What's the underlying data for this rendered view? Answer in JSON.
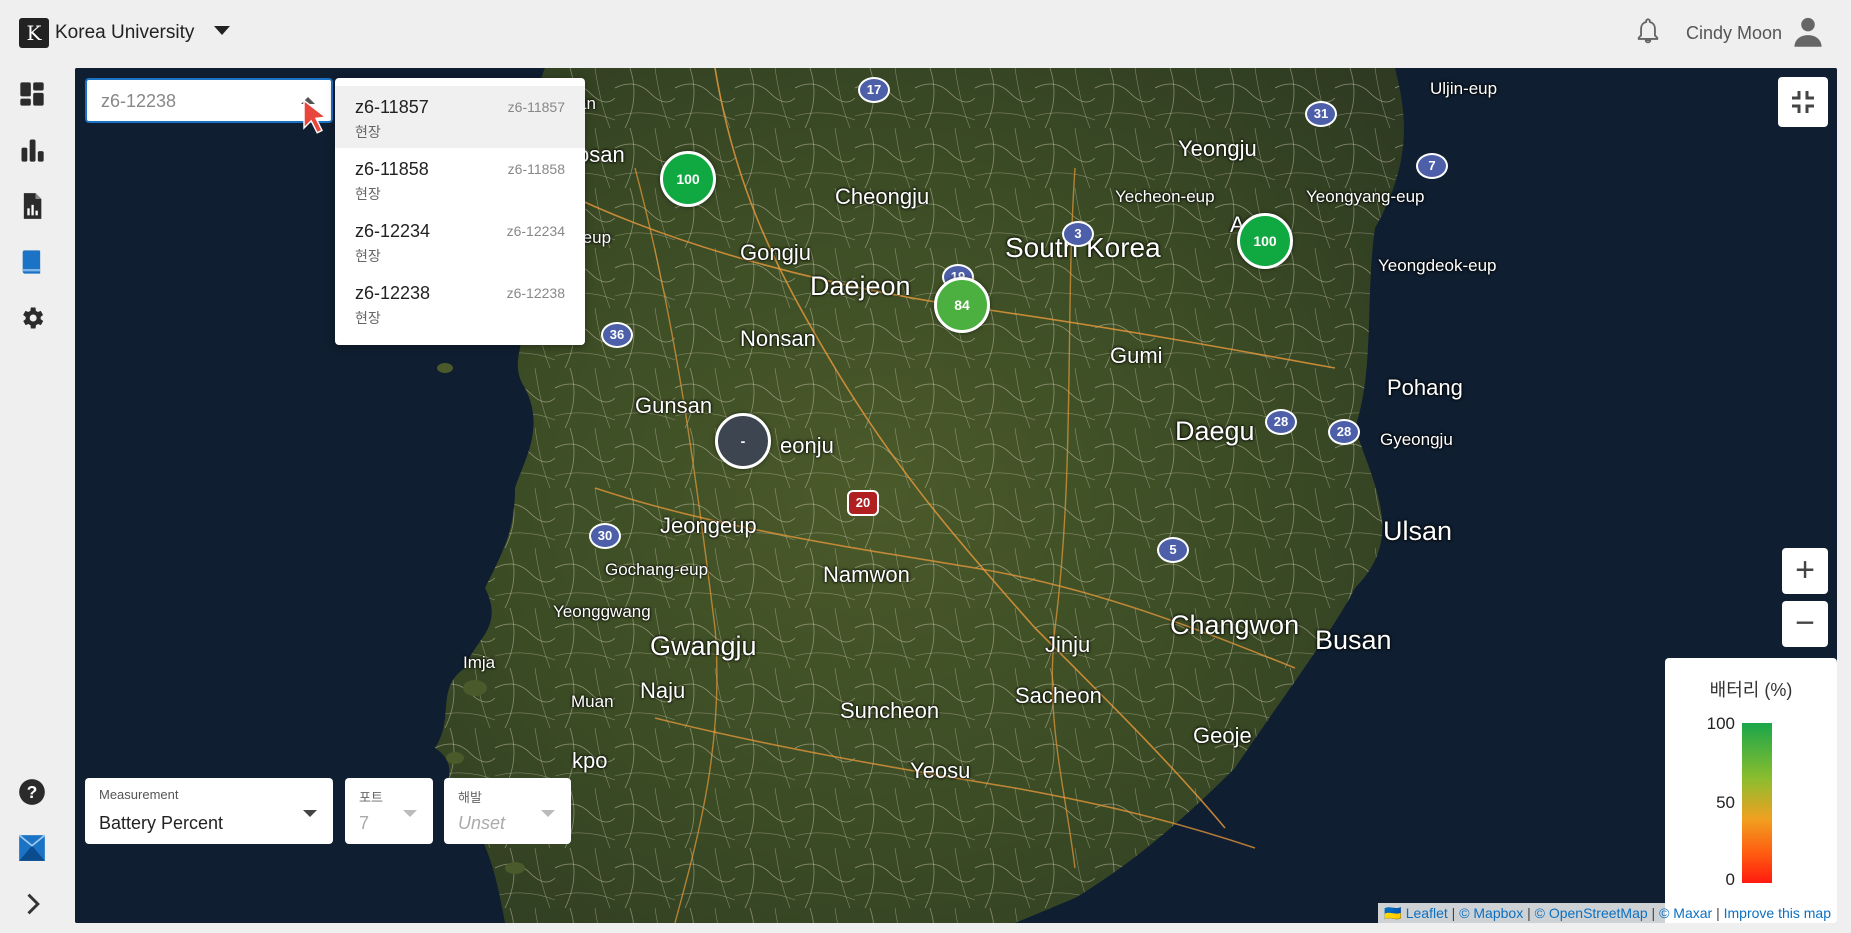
{
  "header": {
    "logo_letter": "K",
    "org_name": "Korea University",
    "user_name": "Cindy Moon"
  },
  "sidebar": {
    "items": [
      {
        "icon": "dashboard-icon"
      },
      {
        "icon": "bar-chart-icon"
      },
      {
        "icon": "report-icon"
      },
      {
        "icon": "book-icon"
      },
      {
        "icon": "gear-icon"
      }
    ],
    "bottom": [
      {
        "icon": "help-icon"
      },
      {
        "icon": "brand-icon"
      },
      {
        "icon": "chevron-right-icon"
      }
    ]
  },
  "search": {
    "value": "z6-12238",
    "options": [
      {
        "name": "z6-11857",
        "code": "z6-11857",
        "sub": "현장",
        "selected": true
      },
      {
        "name": "z6-11858",
        "code": "z6-11858",
        "sub": "현장"
      },
      {
        "name": "z6-12234",
        "code": "z6-12234",
        "sub": "현장"
      },
      {
        "name": "z6-12238",
        "code": "z6-12238",
        "sub": "현장"
      }
    ]
  },
  "map": {
    "cities": {
      "cheongju": "Cheongju",
      "south_korea": "South Korea",
      "daejeon": "Daejeon",
      "gongju": "Gongju",
      "nonsan": "Nonsan",
      "gunsan": "Gunsan",
      "jeonju": "eonju",
      "jeongeup": "Jeongeup",
      "gochang": "Gochang-eup",
      "yeonggwang": "Yeonggwang",
      "gwangju": "Gwangju",
      "namwon": "Namwon",
      "imja": "Imja",
      "muan": "Muan",
      "naju": "Naju",
      "mokpo": "kpo",
      "suncheon": "Suncheon",
      "yeosu": "Yeosu",
      "jinju": "Jinju",
      "sacheon": "Sacheon",
      "changwon": "Changwon",
      "busan": "Busan",
      "geoje": "Geoje",
      "ulsan": "Ulsan",
      "gyeongju": "Gyeongju",
      "pohang": "Pohang",
      "daegu": "Daegu",
      "gumi": "Gumi",
      "yeongju": "Yeongju",
      "yecheon": "Yecheon-eup",
      "andong": "And",
      "yeongyang": "Yeongyang-eup",
      "yeongdeok": "Yeongdeok-eup",
      "uljin": "Uljin-eup",
      "asan": "osan",
      "seosan": "an",
      "hongseong": "-eup"
    },
    "shields": [
      "17",
      "31",
      "7",
      "3",
      "19",
      "36",
      "28",
      "28",
      "20",
      "30",
      "5"
    ],
    "clusters": [
      {
        "label": "100",
        "value": 100,
        "color": "#10a840"
      },
      {
        "label": "100",
        "value": 100,
        "color": "#10a840"
      },
      {
        "label": "84",
        "value": 84,
        "color": "#4cb040"
      },
      {
        "label": "-",
        "value": null,
        "color": "#3d4650"
      }
    ],
    "fullscreen_icon": "exit-fullscreen-icon",
    "zoom_in_label": "+",
    "zoom_out_label": "−"
  },
  "legend": {
    "title": "배터리 (%)",
    "max": "100",
    "mid": "50",
    "min": "0",
    "colors": [
      "#1aa64a",
      "#8cbd2e",
      "#f0a020",
      "#ff1a10"
    ]
  },
  "attribution": {
    "flag": "🇺🇦",
    "leaflet": "Leaflet",
    "mapbox": "© Mapbox",
    "osm": "© OpenStreetMap",
    "maxar": "© Maxar",
    "improve": "Improve this map"
  },
  "controls": {
    "measurement": {
      "label": "Measurement",
      "value": "Battery Percent"
    },
    "port": {
      "label": "포트",
      "value": "7"
    },
    "elevation": {
      "label": "해발",
      "value": "Unset"
    }
  }
}
